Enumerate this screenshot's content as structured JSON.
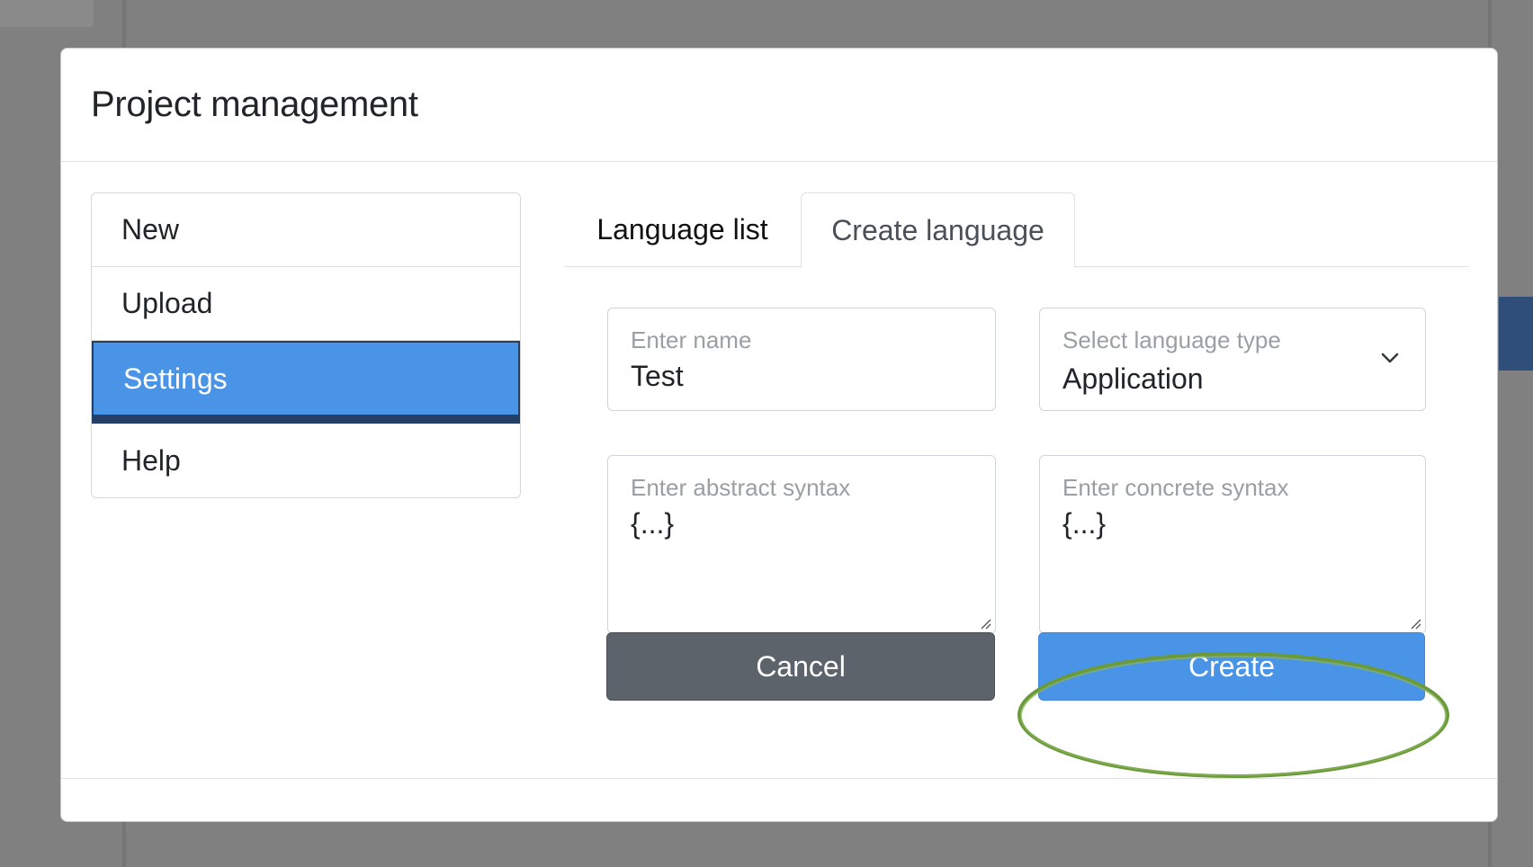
{
  "modal": {
    "title": "Project management"
  },
  "sidebar": {
    "items": [
      {
        "label": "New"
      },
      {
        "label": "Upload"
      },
      {
        "label": "Settings",
        "active": true
      },
      {
        "label": "Help"
      }
    ]
  },
  "tabs": [
    {
      "label": "Language list"
    },
    {
      "label": "Create language",
      "active": true
    }
  ],
  "form": {
    "name": {
      "label": "Enter name",
      "value": "Test"
    },
    "language_type": {
      "label": "Select language type",
      "value": "Application"
    },
    "abstract_syntax": {
      "label": "Enter abstract syntax",
      "value": "{...}"
    },
    "concrete_syntax": {
      "label": "Enter concrete syntax",
      "value": "{...}"
    }
  },
  "buttons": {
    "cancel": "Cancel",
    "create": "Create"
  },
  "colors": {
    "primary": "#4a94e8",
    "secondary": "#5c636a",
    "highlight_ring": "#6a9a3a",
    "overlay": "#808080"
  },
  "icons": {
    "select": "chevron-down-icon",
    "textarea_resize": "resize-handle-icon"
  }
}
